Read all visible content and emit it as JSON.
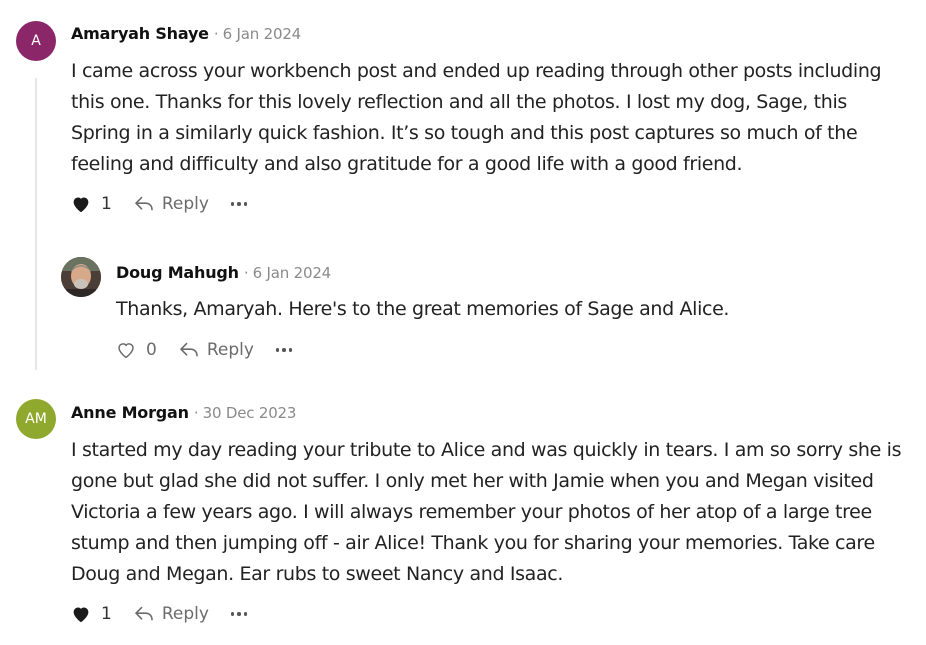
{
  "comments": [
    {
      "author": "Amaryah Shaye",
      "date": "6 Jan 2024",
      "avatar": {
        "initials": "A",
        "color": "#8b2769"
      },
      "body_lines": [
        "I came across your workbench post and ended up reading through other posts including",
        "this one. Thanks for this lovely reflection and all the photos. I lost my dog, Sage, this",
        "Spring in a similarly quick fashion. It’s so tough and this post captures so much of the",
        "feeling and difficulty and also gratitude for a good life with a good friend."
      ],
      "likes": "1",
      "liked": true,
      "reply_label": "Reply"
    },
    {
      "author": "Doug Mahugh",
      "date": "6 Jan 2024",
      "avatar": {
        "initials": "",
        "color": "#7a6455"
      },
      "body_lines": [
        "Thanks, Amaryah. Here's to the great memories of Sage and Alice."
      ],
      "likes": "0",
      "liked": false,
      "reply_label": "Reply"
    },
    {
      "author": "Anne Morgan",
      "date": "30 Dec 2023",
      "avatar": {
        "initials": "AM",
        "color": "#8fa82e"
      },
      "body_lines": [
        "I started my day reading your tribute to Alice and was quickly in tears. I am so sorry she is",
        "gone but glad she did not suffer. I only met her with Jamie when you and Megan visited",
        "Victoria a few years ago. I will always remember your photos of her atop of a large tree",
        "stump and then jumping off - air Alice! Thank you for sharing your memories. Take care",
        "Doug and Megan. Ear rubs to sweet Nancy and Isaac."
      ],
      "likes": "1",
      "liked": true,
      "reply_label": "Reply"
    }
  ],
  "separator": "·",
  "icons": {
    "like": "heart-icon",
    "reply": "reply-arrow-icon",
    "more": "more-dots-icon"
  }
}
